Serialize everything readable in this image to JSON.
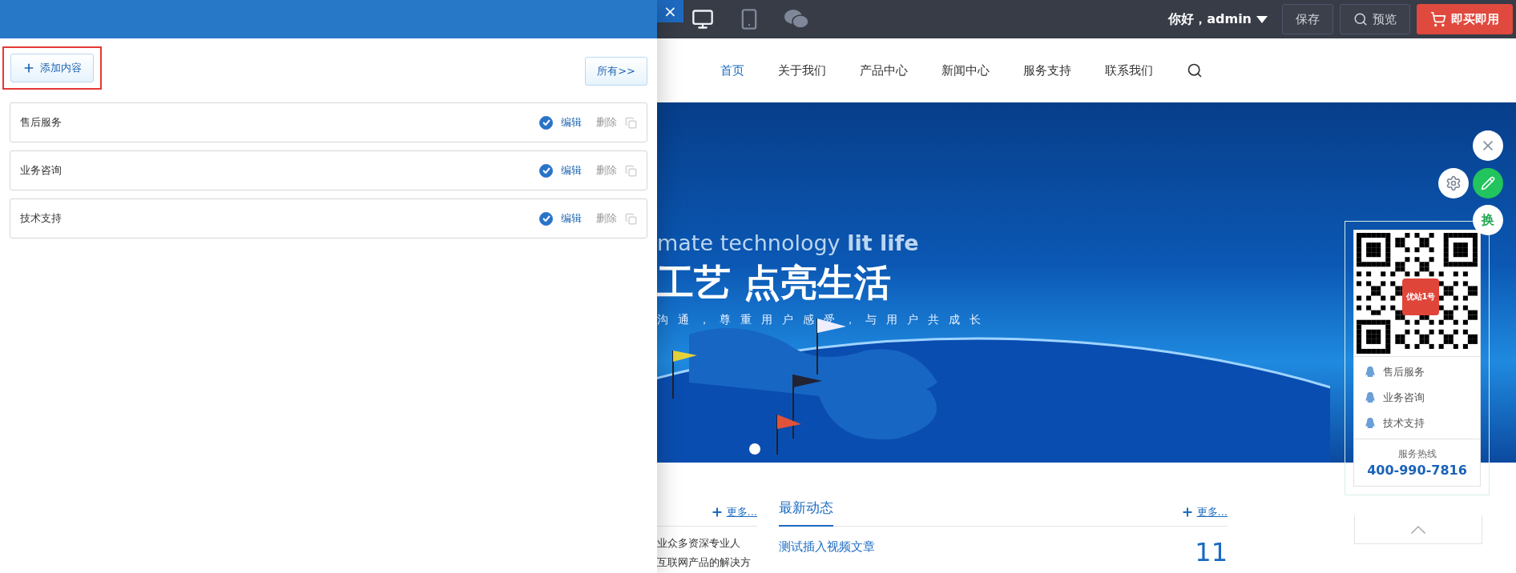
{
  "panel": {
    "add_button": "添加内容",
    "all_button": "所有>>",
    "items": [
      {
        "label": "售后服务",
        "checked": true,
        "edit": "编辑",
        "delete": "删除"
      },
      {
        "label": "业务咨询",
        "checked": true,
        "edit": "编辑",
        "delete": "删除"
      },
      {
        "label": "技术支持",
        "checked": true,
        "edit": "编辑",
        "delete": "删除"
      }
    ]
  },
  "top_bar": {
    "close": "×",
    "devices": [
      {
        "kind": "desktop",
        "selected": true
      },
      {
        "kind": "mobile",
        "selected": false
      },
      {
        "kind": "wechat",
        "selected": false
      }
    ],
    "greeting": "你好，admin",
    "save": "保存",
    "preview": "预览",
    "buy": "即买即用"
  },
  "nav": [
    {
      "label": "首页",
      "selected": true
    },
    {
      "label": "关于我们",
      "selected": false
    },
    {
      "label": "产品中心",
      "selected": false
    },
    {
      "label": "新闻中心",
      "selected": false
    },
    {
      "label": "服务支持",
      "selected": false
    },
    {
      "label": "联系我们",
      "selected": false
    }
  ],
  "hero": {
    "english": "mate technology **lit life**",
    "title": "工艺 点亮生活",
    "subtitle": "沟通，尊重用户感受，与用户共成长"
  },
  "widget": {
    "swap": "换",
    "qr_logo": "优站1号",
    "contacts": [
      "售后服务",
      "业务咨询",
      "技术支持"
    ],
    "hotline_label": "服务热线",
    "hotline": "400-990-7816"
  },
  "sections": {
    "left_more": "更多...",
    "left_lines": [
      "业众多资深专业人",
      "互联网产品的解决方"
    ],
    "news_title": "最新动态",
    "news_more": "更多...",
    "article_title": "测试插入视频文章",
    "article_day": "11"
  }
}
